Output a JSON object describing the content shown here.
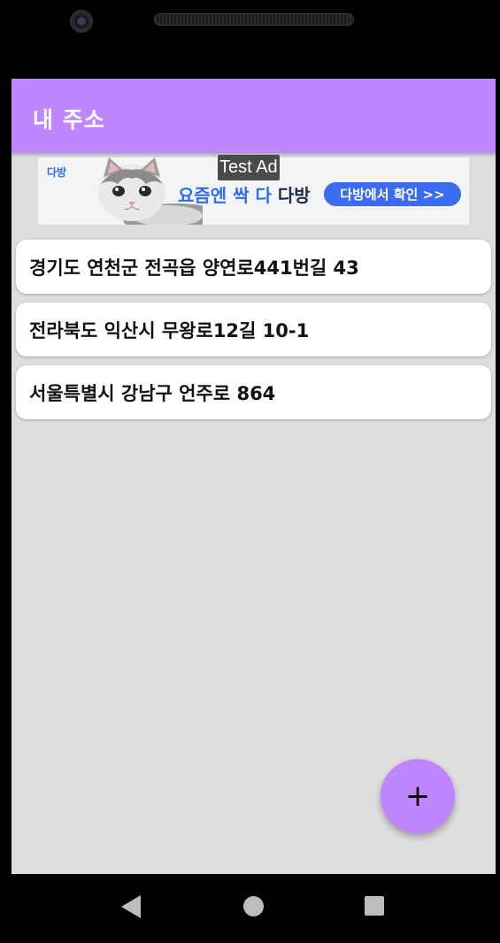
{
  "app": {
    "title": "내 주소"
  },
  "ad": {
    "logo": "다방",
    "headline_part1": "요즘엔 싹 다 ",
    "headline_part2": "다방",
    "cta": "다방에서 확인 >>",
    "test_label": "Test Ad"
  },
  "addresses": [
    {
      "text": "경기도 연천군 전곡읍 양연로441번길 43"
    },
    {
      "text": "전라북도 익산시 무왕로12길 10-1"
    },
    {
      "text": "서울특별시 강남구 언주로 864"
    }
  ],
  "fab": {
    "icon": "plus-icon",
    "symbol": "+"
  },
  "colors": {
    "accent": "#bf86ff",
    "background": "#dedede",
    "ad_blue": "#3b6cf0"
  }
}
